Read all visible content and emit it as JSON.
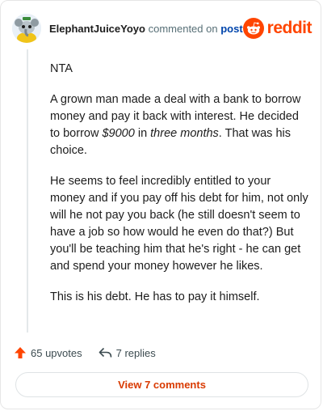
{
  "comment": {
    "username": "ElephantJuiceYoyo",
    "action_text": "commented on",
    "post_link": "post",
    "brand_word": "reddit",
    "paragraphs": {
      "p1": "NTA",
      "p2_a": "A grown man made a deal with a bank to borrow money and pay it back with interest. He decided to borrow ",
      "p2_amount": "$9000",
      "p2_b": " in ",
      "p2_duration": "three months",
      "p2_c": ". That was his choice.",
      "p3": "He seems to feel incredibly entitled to your money and if you pay off his debt for him, not only will he not pay you back (he still doesn't seem to have a job so how would he even do that?) But you'll be teaching him that he's right - he can get and spend your money however he likes.",
      "p4": "This is his debt. He has to pay it himself."
    },
    "upvotes": "65 upvotes",
    "replies": "7 replies",
    "view_comments": "View 7 comments"
  },
  "colors": {
    "brand": "#ff4500",
    "link": "#0045ac",
    "button_text": "#d93a00"
  },
  "icons": {
    "avatar": "snoo-avatar",
    "brand": "reddit-logo-icon",
    "upvote": "upvote-arrow-icon",
    "reply": "reply-arrow-icon"
  }
}
